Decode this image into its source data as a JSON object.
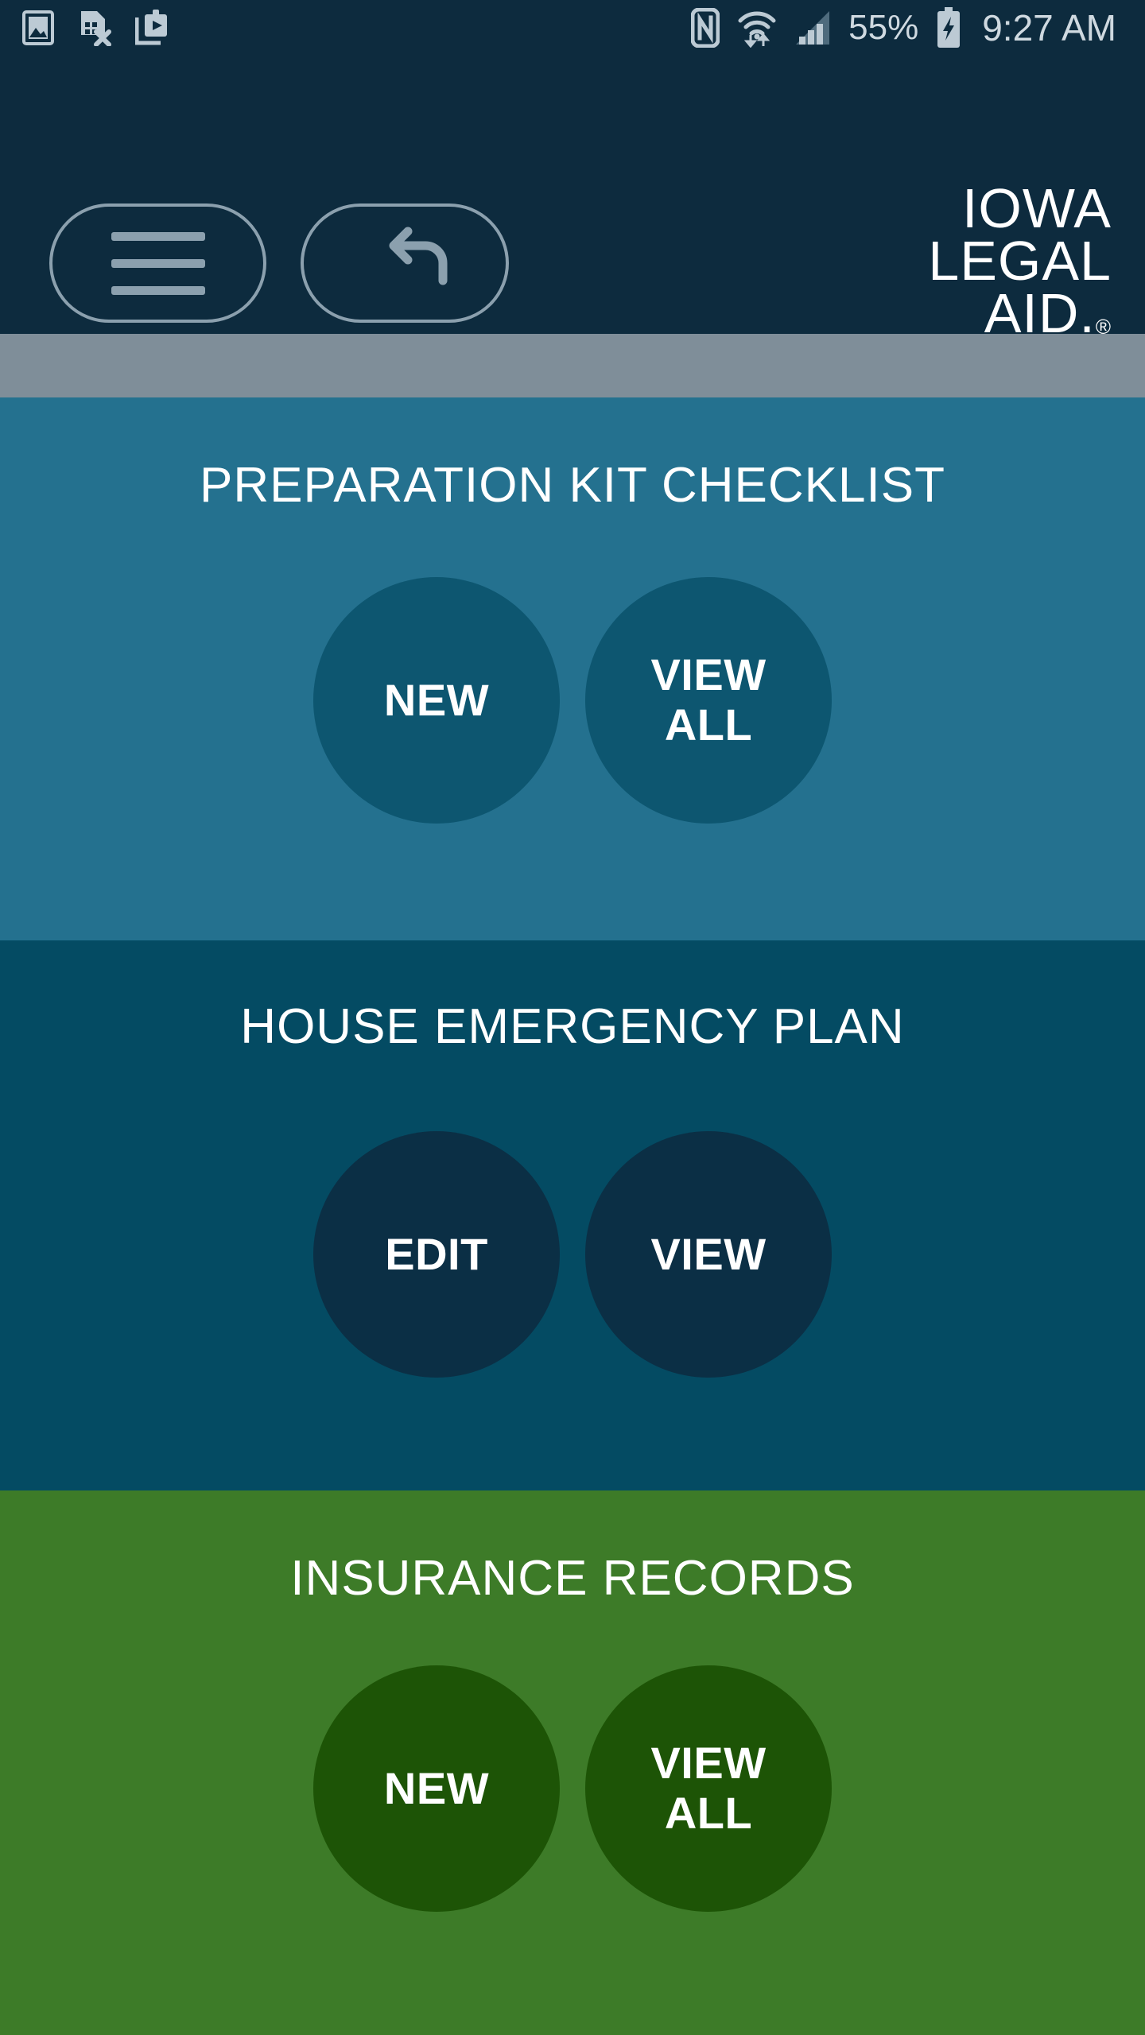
{
  "status_bar": {
    "left_icons": [
      "image-icon",
      "sim-card-error-icon",
      "media-clipboard-icon"
    ],
    "nfc_icon": "nfc-icon",
    "wifi_icon": "wifi-transfer-icon",
    "signal_icon": "cellular-signal-icon",
    "battery_percent": "55%",
    "battery_icon": "battery-charging-icon",
    "time": "9:27 AM"
  },
  "header": {
    "menu_button": "menu-button",
    "back_button": "back-button",
    "logo": {
      "line1": "IOWA",
      "line2": "LEGAL",
      "line3": "AID.",
      "registered": "®"
    }
  },
  "colors": {
    "status_bg": "#0d2b3e",
    "header_bg": "#0d2b3e",
    "divider_bar": "#7f8e99",
    "section_prep_bg": "#24718f",
    "section_prep_circle": "#0d5670",
    "section_house_bg": "#044b63",
    "section_house_circle": "#0b2f45",
    "section_ins_bg": "#3d7b28",
    "section_ins_circle": "#1d5406",
    "text": "#ffffff",
    "status_text": "#cfd9e0",
    "outline": "#8ba0ae"
  },
  "sections": [
    {
      "title": "PREPARATION KIT CHECKLIST",
      "buttons": [
        {
          "label": "NEW"
        },
        {
          "label": "VIEW ALL"
        }
      ]
    },
    {
      "title": "HOUSE EMERGENCY PLAN",
      "buttons": [
        {
          "label": "EDIT"
        },
        {
          "label": "VIEW"
        }
      ]
    },
    {
      "title": "INSURANCE RECORDS",
      "buttons": [
        {
          "label": "NEW"
        },
        {
          "label": "VIEW ALL"
        }
      ]
    }
  ]
}
